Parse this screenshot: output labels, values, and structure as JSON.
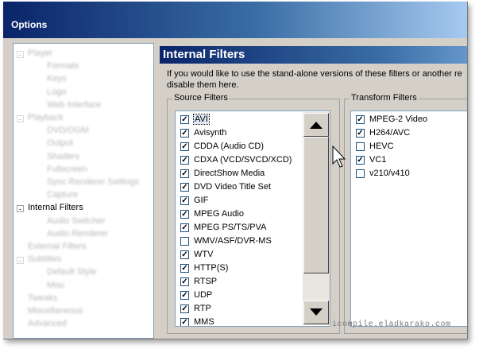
{
  "window": {
    "title": "Options"
  },
  "tree": {
    "items": [
      {
        "label": "Player",
        "blurred": true
      },
      {
        "label": "Formats",
        "blurred": true
      },
      {
        "label": "Keys",
        "blurred": true
      },
      {
        "label": "Logo",
        "blurred": true
      },
      {
        "label": "Web Interface",
        "blurred": true
      },
      {
        "label": "Playback",
        "blurred": true
      },
      {
        "label": "DVD/OGM",
        "blurred": true
      },
      {
        "label": "Output",
        "blurred": true
      },
      {
        "label": "Shaders",
        "blurred": true
      },
      {
        "label": "Fullscreen",
        "blurred": true
      },
      {
        "label": "Sync Renderer Settings",
        "blurred": true
      },
      {
        "label": "Capture",
        "blurred": true
      },
      {
        "label": "Internal Filters",
        "blurred": false,
        "selected": true
      },
      {
        "label": "Audio Switcher",
        "blurred": true
      },
      {
        "label": "Audio Renderer",
        "blurred": true
      },
      {
        "label": "External Filters",
        "blurred": true
      },
      {
        "label": "Subtitles",
        "blurred": true
      },
      {
        "label": "Default Style",
        "blurred": true
      },
      {
        "label": "Misc",
        "blurred": true
      },
      {
        "label": "Tweaks",
        "blurred": true
      },
      {
        "label": "Miscellaneous",
        "blurred": true
      },
      {
        "label": "Advanced",
        "blurred": true
      }
    ]
  },
  "panel": {
    "heading": "Internal Filters",
    "description": "If you would like to use the stand-alone versions of these filters or another re disable them here.",
    "source_filters": {
      "label": "Source Filters",
      "items": [
        {
          "label": "AVI",
          "checked": true,
          "focused": true
        },
        {
          "label": "Avisynth",
          "checked": true
        },
        {
          "label": "CDDA (Audio CD)",
          "checked": true
        },
        {
          "label": "CDXA (VCD/SVCD/XCD)",
          "checked": true
        },
        {
          "label": "DirectShow Media",
          "checked": true
        },
        {
          "label": "DVD Video Title Set",
          "checked": true
        },
        {
          "label": "GIF",
          "checked": true
        },
        {
          "label": "MPEG Audio",
          "checked": true
        },
        {
          "label": "MPEG PS/TS/PVA",
          "checked": true
        },
        {
          "label": "WMV/ASF/DVR-MS",
          "checked": false
        },
        {
          "label": "WTV",
          "checked": true
        },
        {
          "label": "HTTP(S)",
          "checked": true
        },
        {
          "label": "RTSP",
          "checked": true
        },
        {
          "label": "UDP",
          "checked": true
        },
        {
          "label": "RTP",
          "checked": true
        },
        {
          "label": "MMS",
          "checked": true
        }
      ]
    },
    "transform_filters": {
      "label": "Transform Filters",
      "items": [
        {
          "label": "MPEG-2 Video",
          "checked": true
        },
        {
          "label": "H264/AVC",
          "checked": true
        },
        {
          "label": "HEVC",
          "checked": false
        },
        {
          "label": "VC1",
          "checked": true
        },
        {
          "label": "v210/v410",
          "checked": false
        }
      ]
    }
  },
  "watermark": "icompile.eladkarako.com",
  "icons": {
    "scroll_up": "triangle-up",
    "scroll_down": "triangle-down",
    "cursor": "arrow-pointer"
  }
}
